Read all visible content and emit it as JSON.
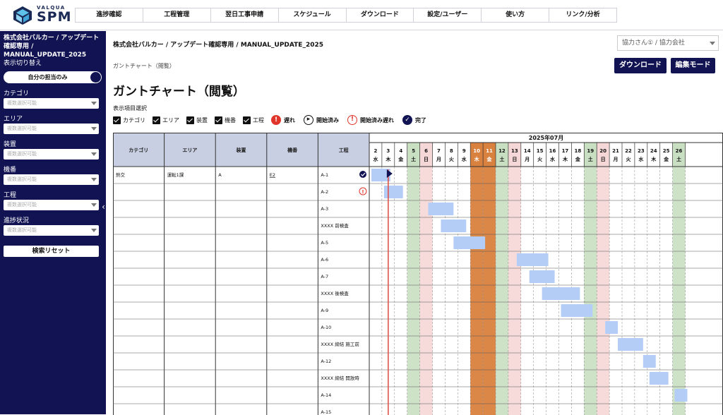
{
  "brand": {
    "top": "VALQUA",
    "name": "SPM"
  },
  "nav": [
    "進捗確認",
    "工程管理",
    "翌日工事申請",
    "スケジュール",
    "ダウンロード",
    "設定/ユーザー",
    "使い方",
    "リンク/分析"
  ],
  "sidebar": {
    "project": "株式会社バルカー / アップデート確認専用 / MANUAL_UPDATE_2025",
    "view_switch_label": "表示切り替え",
    "toggle_label": "自分の担当のみ",
    "filters": [
      {
        "label": "カテゴリ",
        "placeholder": "複数選択可能"
      },
      {
        "label": "エリア",
        "placeholder": "複数選択可能"
      },
      {
        "label": "装置",
        "placeholder": "複数選択可能"
      },
      {
        "label": "機番",
        "placeholder": "複数選択可能"
      },
      {
        "label": "工程",
        "placeholder": "複数選択可能"
      },
      {
        "label": "進捗状況",
        "placeholder": "複数選択可能"
      }
    ],
    "reset_label": "検索リセット"
  },
  "main": {
    "breadcrumb": "株式会社バルカー / アップデート確認専用 / MANUAL_UPDATE_2025",
    "company_select": "協力さん① / 協力会社",
    "subtitle": "ガントチャート（閲覧）",
    "download_label": "ダウンロード",
    "edit_label": "編集モード",
    "title": "ガントチャート（閲覧）",
    "display_items_label": "表示項目選択",
    "options": [
      "カテゴリ",
      "エリア",
      "装置",
      "機番",
      "工程"
    ],
    "legend": [
      {
        "label": "遅れ",
        "kind": "late"
      },
      {
        "label": "開始済み",
        "kind": "started"
      },
      {
        "label": "開始済み遅れ",
        "kind": "started-late"
      },
      {
        "label": "完了",
        "kind": "done"
      }
    ]
  },
  "gantt": {
    "month": "2025年07月",
    "columns": [
      "カテゴリ",
      "エリア",
      "装置",
      "機番",
      "工程"
    ],
    "days": [
      {
        "d": "2",
        "w": "水",
        "t": "n"
      },
      {
        "d": "3",
        "w": "木",
        "t": "n"
      },
      {
        "d": "4",
        "w": "金",
        "t": "n"
      },
      {
        "d": "5",
        "w": "土",
        "t": "sat"
      },
      {
        "d": "6",
        "w": "日",
        "t": "sun"
      },
      {
        "d": "7",
        "w": "月",
        "t": "n"
      },
      {
        "d": "8",
        "w": "火",
        "t": "n"
      },
      {
        "d": "9",
        "w": "水",
        "t": "n"
      },
      {
        "d": "10",
        "w": "木",
        "t": "hol"
      },
      {
        "d": "11",
        "w": "金",
        "t": "hol"
      },
      {
        "d": "12",
        "w": "土",
        "t": "sat"
      },
      {
        "d": "13",
        "w": "日",
        "t": "sun"
      },
      {
        "d": "14",
        "w": "月",
        "t": "n"
      },
      {
        "d": "15",
        "w": "火",
        "t": "n"
      },
      {
        "d": "16",
        "w": "水",
        "t": "n"
      },
      {
        "d": "17",
        "w": "木",
        "t": "n"
      },
      {
        "d": "18",
        "w": "金",
        "t": "n"
      },
      {
        "d": "19",
        "w": "土",
        "t": "sat"
      },
      {
        "d": "20",
        "w": "日",
        "t": "sun"
      },
      {
        "d": "21",
        "w": "月",
        "t": "n"
      },
      {
        "d": "22",
        "w": "火",
        "t": "n"
      },
      {
        "d": "23",
        "w": "水",
        "t": "n"
      },
      {
        "d": "24",
        "w": "木",
        "t": "n"
      },
      {
        "d": "25",
        "w": "金",
        "t": "n"
      },
      {
        "d": "26",
        "w": "土",
        "t": "sat"
      }
    ],
    "today_index": 1,
    "colors": {
      "sat": "#c9dfc2",
      "sun": "#f6d7d7",
      "hol": "#d9813e",
      "bar": "#b3cdf6",
      "today": "#e0483e",
      "header": "#c9cfe2"
    },
    "rows": [
      {
        "cells": [
          "熱交",
          "運転1課",
          "A",
          "E2",
          "A-1"
        ],
        "status": "done",
        "start": 0,
        "len": 1.5
      },
      {
        "cells": [
          "",
          "",
          "",
          "",
          "A-2"
        ],
        "status": "started-late",
        "start": 1,
        "len": 1.5
      },
      {
        "cells": [
          "",
          "",
          "",
          "",
          "A-3"
        ],
        "status": "",
        "start": 4.5,
        "len": 2
      },
      {
        "cells": [
          "",
          "",
          "",
          "",
          "XXXX 前検査"
        ],
        "status": "",
        "start": 5.5,
        "len": 2
      },
      {
        "cells": [
          "",
          "",
          "",
          "",
          "A-5"
        ],
        "status": "",
        "start": 6.5,
        "len": 2.5
      },
      {
        "cells": [
          "",
          "",
          "",
          "",
          "A-6"
        ],
        "status": "",
        "start": 11.5,
        "len": 2.5
      },
      {
        "cells": [
          "",
          "",
          "",
          "",
          "A-7"
        ],
        "status": "",
        "start": 12.5,
        "len": 2
      },
      {
        "cells": [
          "",
          "",
          "",
          "",
          "XXXX 後検査"
        ],
        "status": "",
        "start": 13.5,
        "len": 3
      },
      {
        "cells": [
          "",
          "",
          "",
          "",
          "A-9"
        ],
        "status": "",
        "start": 15,
        "len": 2.5
      },
      {
        "cells": [
          "",
          "",
          "",
          "",
          "A-10"
        ],
        "status": "",
        "start": 18.5,
        "len": 1
      },
      {
        "cells": [
          "",
          "",
          "",
          "",
          "XXXX 締結 施工前"
        ],
        "status": "",
        "start": 19.5,
        "len": 2
      },
      {
        "cells": [
          "",
          "",
          "",
          "",
          "A-12"
        ],
        "status": "",
        "start": 21.5,
        "len": 1
      },
      {
        "cells": [
          "",
          "",
          "",
          "",
          "XXXX 締結 開放時"
        ],
        "status": "",
        "start": 22,
        "len": 1.5
      },
      {
        "cells": [
          "",
          "",
          "",
          "",
          "A-14"
        ],
        "status": "",
        "start": 24,
        "len": 1
      },
      {
        "cells": [
          "",
          "",
          "",
          "",
          "A-15"
        ],
        "status": "",
        "start": -1,
        "len": 0
      }
    ]
  }
}
